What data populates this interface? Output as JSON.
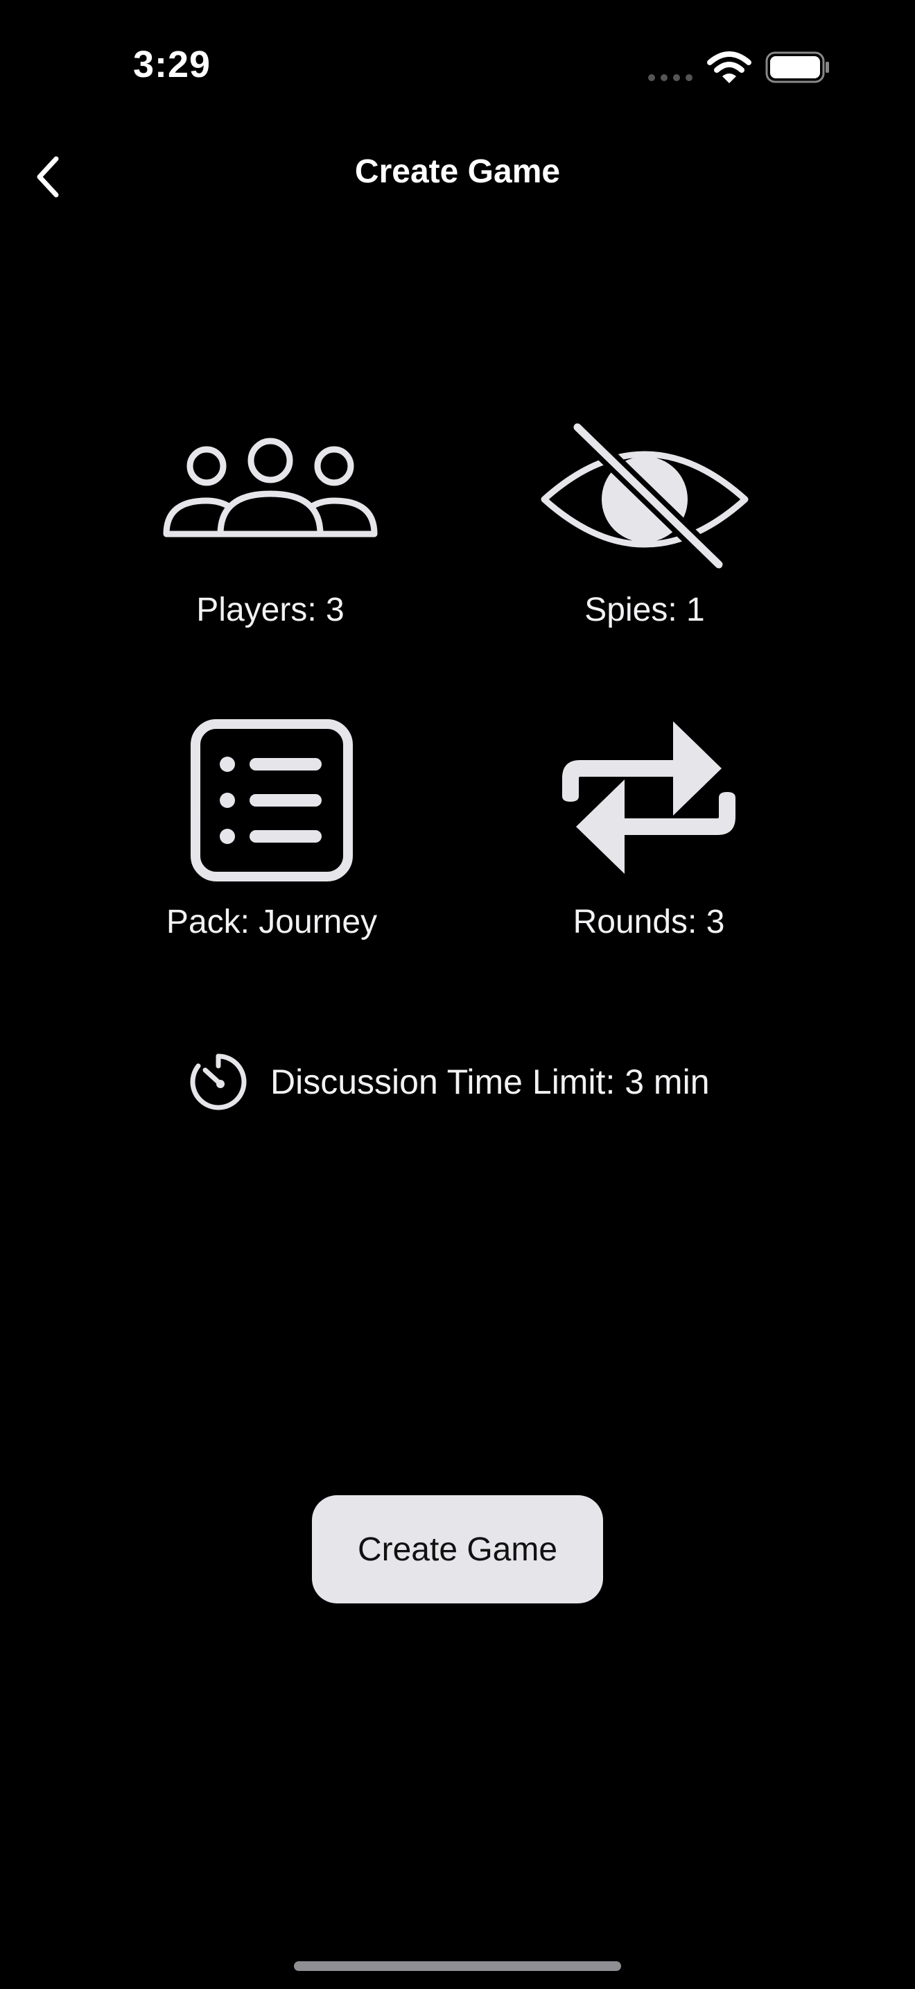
{
  "status_bar": {
    "time": "3:29"
  },
  "nav": {
    "title": "Create Game",
    "back_icon": "chevron-left-icon"
  },
  "options": {
    "players": {
      "label": "Players: 3",
      "icon": "people-icon"
    },
    "spies": {
      "label": "Spies: 1",
      "icon": "eye-slash-icon"
    },
    "pack": {
      "label": "Pack: Journey",
      "icon": "list-icon"
    },
    "rounds": {
      "label": "Rounds: 3",
      "icon": "repeat-icon"
    }
  },
  "timer": {
    "label": "Discussion Time Limit: 3 min",
    "icon": "timer-icon"
  },
  "actions": {
    "create_label": "Create Game"
  },
  "colors": {
    "background": "#000000",
    "icon": "#e5e5ea",
    "button_bg": "#e5e5ea",
    "button_text": "#111111"
  }
}
